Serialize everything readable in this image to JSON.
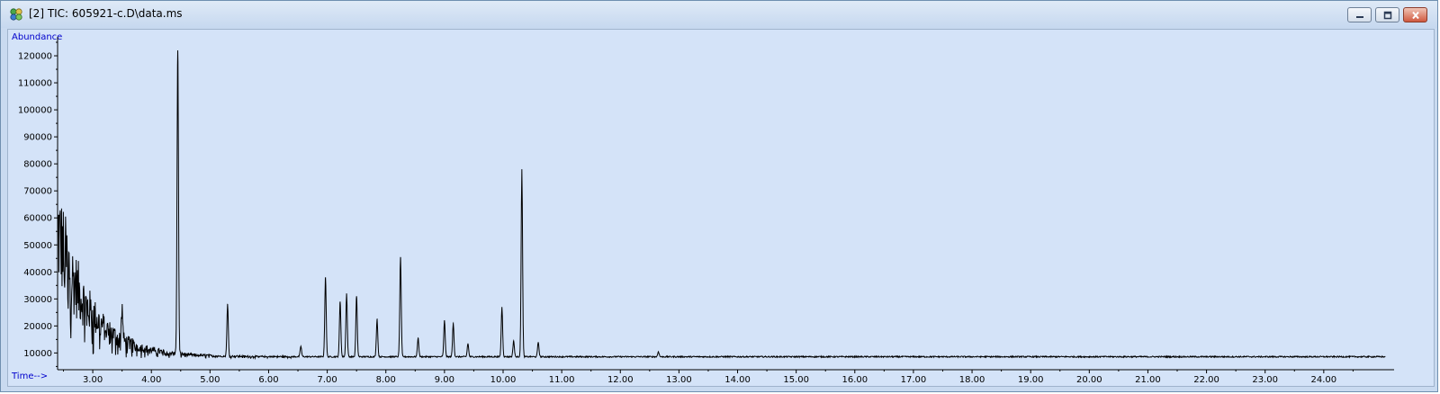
{
  "window": {
    "title": "[2] TIC: 605921-c.D\\data.ms",
    "buttons": {
      "minimize": "minimize-icon",
      "restore": "restore-icon",
      "close": "close-icon"
    },
    "colors": {
      "titlebar": "#d0def2",
      "plot_background": "#d4e3f8",
      "trace": "#000000",
      "axis_labels": "#0000cc"
    }
  },
  "chart_data": {
    "type": "line",
    "title": "",
    "xlabel": "Time-->",
    "ylabel": "Abundance",
    "xlim": [
      2.4,
      25.2
    ],
    "ylim": [
      3800,
      127000
    ],
    "grid": false,
    "x_ticks": [
      "3.00",
      "4.00",
      "5.00",
      "6.00",
      "7.00",
      "8.00",
      "9.00",
      "10.00",
      "11.00",
      "12.00",
      "13.00",
      "14.00",
      "15.00",
      "16.00",
      "17.00",
      "18.00",
      "19.00",
      "20.00",
      "21.00",
      "22.00",
      "23.00",
      "24.00"
    ],
    "y_ticks": [
      "10000",
      "20000",
      "30000",
      "40000",
      "50000",
      "60000",
      "70000",
      "80000",
      "90000",
      "100000",
      "110000",
      "120000"
    ],
    "series": [
      {
        "baseline": {
          "start_value": 55000,
          "tail_value": 8600,
          "decay_minutes": 0.55
        },
        "peaks": [
          {
            "x": 3.5,
            "y": 26500
          },
          {
            "x": 4.45,
            "y": 122000
          },
          {
            "x": 5.3,
            "y": 28000
          },
          {
            "x": 6.55,
            "y": 12500
          },
          {
            "x": 6.97,
            "y": 38000
          },
          {
            "x": 7.22,
            "y": 29000
          },
          {
            "x": 7.33,
            "y": 32000
          },
          {
            "x": 7.5,
            "y": 31000
          },
          {
            "x": 7.85,
            "y": 22500
          },
          {
            "x": 8.25,
            "y": 45500
          },
          {
            "x": 8.55,
            "y": 15500
          },
          {
            "x": 9.0,
            "y": 22000
          },
          {
            "x": 9.15,
            "y": 21000
          },
          {
            "x": 9.4,
            "y": 13500
          },
          {
            "x": 9.98,
            "y": 27000
          },
          {
            "x": 10.18,
            "y": 14500
          },
          {
            "x": 10.32,
            "y": 78000
          },
          {
            "x": 10.6,
            "y": 14000
          },
          {
            "x": 12.65,
            "y": 10500
          }
        ]
      }
    ]
  }
}
